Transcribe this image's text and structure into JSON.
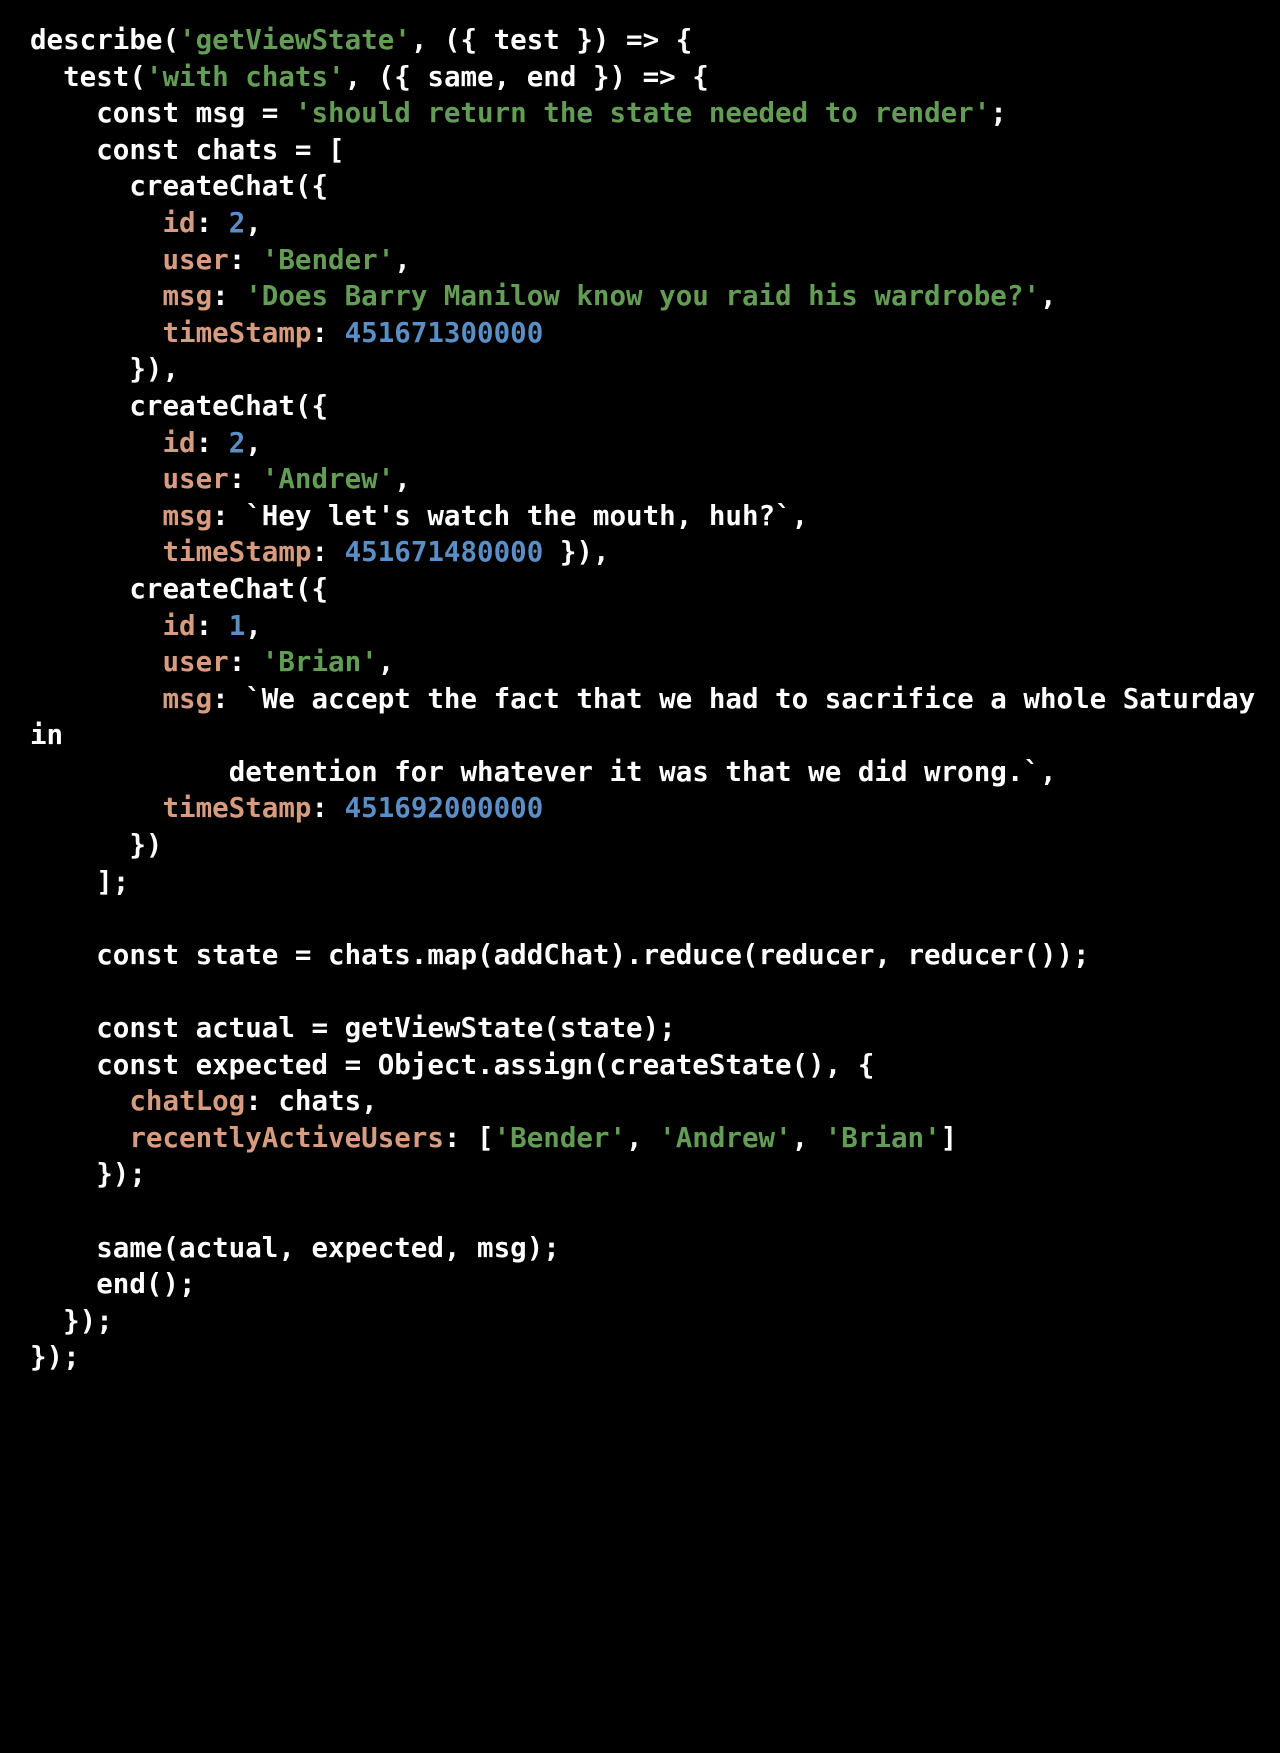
{
  "editor": {
    "language": "javascript",
    "background_color": "#000000",
    "theme_colors": {
      "plain": "#ffffff",
      "string": "#639c55",
      "property_key": "#d79c80",
      "number": "#5a8ec7",
      "punctuation": "#ffffff"
    }
  },
  "code": {
    "lines": [
      {
        "id": "l1",
        "tokens": [
          {
            "t": "plain",
            "v": "describe("
          },
          {
            "t": "string",
            "v": "'getViewState'"
          },
          {
            "t": "plain",
            "v": ", ({ test }) => {"
          }
        ]
      },
      {
        "id": "l2",
        "tokens": [
          {
            "t": "plain",
            "v": "  test("
          },
          {
            "t": "string",
            "v": "'with chats'"
          },
          {
            "t": "plain",
            "v": ", ({ same, end }) => {"
          }
        ]
      },
      {
        "id": "l3",
        "tokens": [
          {
            "t": "plain",
            "v": "    const msg = "
          },
          {
            "t": "string",
            "v": "'should return the state needed to render'"
          },
          {
            "t": "plain",
            "v": ";"
          }
        ]
      },
      {
        "id": "l4",
        "tokens": [
          {
            "t": "plain",
            "v": "    const chats = ["
          }
        ]
      },
      {
        "id": "l5",
        "tokens": [
          {
            "t": "plain",
            "v": "      createChat({"
          }
        ]
      },
      {
        "id": "l6",
        "tokens": [
          {
            "t": "plain",
            "v": "        "
          },
          {
            "t": "key",
            "v": "id"
          },
          {
            "t": "punct",
            "v": ": "
          },
          {
            "t": "number",
            "v": "2"
          },
          {
            "t": "punct",
            "v": ","
          }
        ]
      },
      {
        "id": "l7",
        "tokens": [
          {
            "t": "plain",
            "v": "        "
          },
          {
            "t": "key",
            "v": "user"
          },
          {
            "t": "punct",
            "v": ": "
          },
          {
            "t": "string",
            "v": "'Bender'"
          },
          {
            "t": "punct",
            "v": ","
          }
        ]
      },
      {
        "id": "l8",
        "tokens": [
          {
            "t": "plain",
            "v": "        "
          },
          {
            "t": "key",
            "v": "msg"
          },
          {
            "t": "punct",
            "v": ": "
          },
          {
            "t": "string",
            "v": "'Does Barry Manilow know you raid his wardrobe?'"
          },
          {
            "t": "punct",
            "v": ","
          }
        ]
      },
      {
        "id": "l9",
        "tokens": [
          {
            "t": "plain",
            "v": "        "
          },
          {
            "t": "key",
            "v": "timeStamp"
          },
          {
            "t": "punct",
            "v": ": "
          },
          {
            "t": "number",
            "v": "451671300000"
          }
        ]
      },
      {
        "id": "l10",
        "tokens": [
          {
            "t": "plain",
            "v": "      }),"
          }
        ]
      },
      {
        "id": "l11",
        "tokens": [
          {
            "t": "plain",
            "v": "      createChat({"
          }
        ]
      },
      {
        "id": "l12",
        "tokens": [
          {
            "t": "plain",
            "v": "        "
          },
          {
            "t": "key",
            "v": "id"
          },
          {
            "t": "punct",
            "v": ": "
          },
          {
            "t": "number",
            "v": "2"
          },
          {
            "t": "punct",
            "v": ","
          }
        ]
      },
      {
        "id": "l13",
        "tokens": [
          {
            "t": "plain",
            "v": "        "
          },
          {
            "t": "key",
            "v": "user"
          },
          {
            "t": "punct",
            "v": ": "
          },
          {
            "t": "string",
            "v": "'Andrew'"
          },
          {
            "t": "punct",
            "v": ","
          }
        ]
      },
      {
        "id": "l14",
        "tokens": [
          {
            "t": "plain",
            "v": "        "
          },
          {
            "t": "key",
            "v": "msg"
          },
          {
            "t": "punct",
            "v": ": "
          },
          {
            "t": "plain",
            "v": "`Hey let's watch the mouth, huh?`,"
          }
        ]
      },
      {
        "id": "l15",
        "tokens": [
          {
            "t": "plain",
            "v": "        "
          },
          {
            "t": "key",
            "v": "timeStamp"
          },
          {
            "t": "punct",
            "v": ": "
          },
          {
            "t": "number",
            "v": "451671480000"
          },
          {
            "t": "plain",
            "v": " }),"
          }
        ]
      },
      {
        "id": "l16",
        "tokens": [
          {
            "t": "plain",
            "v": "      createChat({"
          }
        ]
      },
      {
        "id": "l17",
        "tokens": [
          {
            "t": "plain",
            "v": "        "
          },
          {
            "t": "key",
            "v": "id"
          },
          {
            "t": "punct",
            "v": ": "
          },
          {
            "t": "number",
            "v": "1"
          },
          {
            "t": "punct",
            "v": ","
          }
        ]
      },
      {
        "id": "l18",
        "tokens": [
          {
            "t": "plain",
            "v": "        "
          },
          {
            "t": "key",
            "v": "user"
          },
          {
            "t": "punct",
            "v": ": "
          },
          {
            "t": "string",
            "v": "'Brian'"
          },
          {
            "t": "punct",
            "v": ","
          }
        ]
      },
      {
        "id": "l19",
        "tokens": [
          {
            "t": "plain",
            "v": "        "
          },
          {
            "t": "key",
            "v": "msg"
          },
          {
            "t": "punct",
            "v": ": "
          },
          {
            "t": "plain",
            "v": "`We accept the fact that we had to sacrifice a whole Saturday in"
          }
        ]
      },
      {
        "id": "l20",
        "tokens": [
          {
            "t": "plain",
            "v": "            detention for whatever it was that we did wrong.`,"
          }
        ]
      },
      {
        "id": "l21",
        "tokens": [
          {
            "t": "plain",
            "v": "        "
          },
          {
            "t": "key",
            "v": "timeStamp"
          },
          {
            "t": "punct",
            "v": ": "
          },
          {
            "t": "number",
            "v": "451692000000"
          }
        ]
      },
      {
        "id": "l22",
        "tokens": [
          {
            "t": "plain",
            "v": "      })"
          }
        ]
      },
      {
        "id": "l23",
        "tokens": [
          {
            "t": "plain",
            "v": "    ];"
          }
        ]
      },
      {
        "id": "l24",
        "tokens": [
          {
            "t": "plain",
            "v": " "
          }
        ],
        "blank": true
      },
      {
        "id": "l25",
        "tokens": [
          {
            "t": "plain",
            "v": "    const state = chats.map(addChat).reduce(reducer, reducer());"
          }
        ]
      },
      {
        "id": "l26",
        "tokens": [
          {
            "t": "plain",
            "v": " "
          }
        ],
        "blank": true
      },
      {
        "id": "l27",
        "tokens": [
          {
            "t": "plain",
            "v": "    const actual = getViewState(state);"
          }
        ]
      },
      {
        "id": "l28",
        "tokens": [
          {
            "t": "plain",
            "v": "    const expected = Object.assign(createState(), {"
          }
        ]
      },
      {
        "id": "l29",
        "tokens": [
          {
            "t": "plain",
            "v": "      "
          },
          {
            "t": "key",
            "v": "chatLog"
          },
          {
            "t": "punct",
            "v": ": chats,"
          }
        ]
      },
      {
        "id": "l30",
        "tokens": [
          {
            "t": "plain",
            "v": "      "
          },
          {
            "t": "key",
            "v": "recentlyActiveUsers"
          },
          {
            "t": "punct",
            "v": ": ["
          },
          {
            "t": "string",
            "v": "'Bender'"
          },
          {
            "t": "punct",
            "v": ", "
          },
          {
            "t": "string",
            "v": "'Andrew'"
          },
          {
            "t": "punct",
            "v": ", "
          },
          {
            "t": "string",
            "v": "'Brian'"
          },
          {
            "t": "punct",
            "v": "]"
          }
        ]
      },
      {
        "id": "l31",
        "tokens": [
          {
            "t": "plain",
            "v": "    });"
          }
        ]
      },
      {
        "id": "l32",
        "tokens": [
          {
            "t": "plain",
            "v": " "
          }
        ],
        "blank": true
      },
      {
        "id": "l33",
        "tokens": [
          {
            "t": "plain",
            "v": "    same(actual, expected, msg);"
          }
        ]
      },
      {
        "id": "l34",
        "tokens": [
          {
            "t": "plain",
            "v": "    end();"
          }
        ]
      },
      {
        "id": "l35",
        "tokens": [
          {
            "t": "plain",
            "v": "  });"
          }
        ]
      },
      {
        "id": "l36",
        "tokens": [
          {
            "t": "plain",
            "v": "});"
          }
        ]
      }
    ]
  }
}
